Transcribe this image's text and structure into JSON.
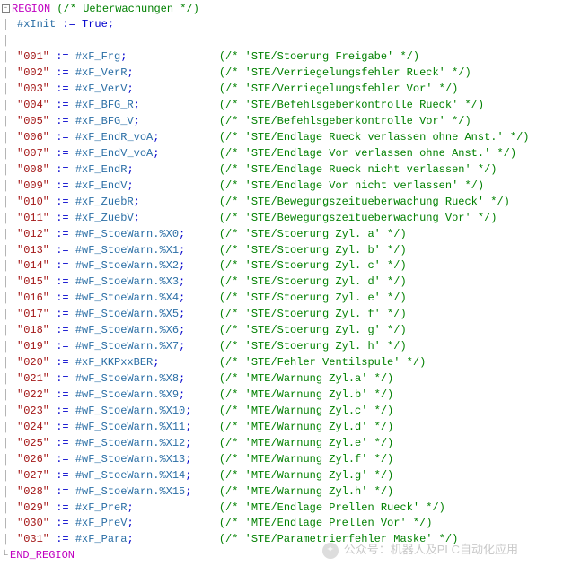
{
  "region": {
    "open_kw": "REGION",
    "close_kw": "END_REGION",
    "label_cmt": "(/* Ueberwachungen */)"
  },
  "init": {
    "target": "#xInit",
    "assign": ":=",
    "value": "True",
    "semi": ";"
  },
  "rows": [
    {
      "key": "\"001\"",
      "op": ":=",
      "var": "#xF_Frg",
      "semi": ";",
      "cmt": "(/* 'STE/Stoerung Freigabe' */)"
    },
    {
      "key": "\"002\"",
      "op": ":=",
      "var": "#xF_VerR",
      "semi": ";",
      "cmt": "(/* 'STE/Verriegelungsfehler Rueck' */)"
    },
    {
      "key": "\"003\"",
      "op": ":=",
      "var": "#xF_VerV",
      "semi": ";",
      "cmt": "(/* 'STE/Verriegelungsfehler Vor' */)"
    },
    {
      "key": "\"004\"",
      "op": ":=",
      "var": "#xF_BFG_R",
      "semi": ";",
      "cmt": "(/* 'STE/Befehlsgeberkontrolle Rueck' */)"
    },
    {
      "key": "\"005\"",
      "op": ":=",
      "var": "#xF_BFG_V",
      "semi": ";",
      "cmt": "(/* 'STE/Befehlsgeberkontrolle Vor' */)"
    },
    {
      "key": "\"006\"",
      "op": ":=",
      "var": "#xF_EndR_voA",
      "semi": ";",
      "cmt": "(/* 'STE/Endlage Rueck verlassen ohne Anst.' */)"
    },
    {
      "key": "\"007\"",
      "op": ":=",
      "var": "#xF_EndV_voA",
      "semi": ";",
      "cmt": "(/* 'STE/Endlage Vor verlassen ohne Anst.' */)"
    },
    {
      "key": "\"008\"",
      "op": ":=",
      "var": "#xF_EndR",
      "semi": ";",
      "cmt": "(/* 'STE/Endlage Rueck nicht verlassen' */)"
    },
    {
      "key": "\"009\"",
      "op": ":=",
      "var": "#xF_EndV",
      "semi": ";",
      "cmt": "(/* 'STE/Endlage Vor nicht verlassen' */)"
    },
    {
      "key": "\"010\"",
      "op": ":=",
      "var": "#xF_ZuebR",
      "semi": ";",
      "cmt": "(/* 'STE/Bewegungszeitueberwachung Rueck' */)"
    },
    {
      "key": "\"011\"",
      "op": ":=",
      "var": "#xF_ZuebV",
      "semi": ";",
      "cmt": "(/* 'STE/Bewegungszeitueberwachung Vor' */)"
    },
    {
      "key": "\"012\"",
      "op": ":=",
      "var": "#wF_StoeWarn.%X0",
      "semi": ";",
      "cmt": "(/* 'STE/Stoerung Zyl. a' */)"
    },
    {
      "key": "\"013\"",
      "op": ":=",
      "var": "#wF_StoeWarn.%X1",
      "semi": ";",
      "cmt": "(/* 'STE/Stoerung Zyl. b' */)"
    },
    {
      "key": "\"014\"",
      "op": ":=",
      "var": "#wF_StoeWarn.%X2",
      "semi": ";",
      "cmt": "(/* 'STE/Stoerung Zyl. c' */)"
    },
    {
      "key": "\"015\"",
      "op": ":=",
      "var": "#wF_StoeWarn.%X3",
      "semi": ";",
      "cmt": "(/* 'STE/Stoerung Zyl. d' */)"
    },
    {
      "key": "\"016\"",
      "op": ":=",
      "var": "#wF_StoeWarn.%X4",
      "semi": ";",
      "cmt": "(/* 'STE/Stoerung Zyl. e' */)"
    },
    {
      "key": "\"017\"",
      "op": ":=",
      "var": "#wF_StoeWarn.%X5",
      "semi": ";",
      "cmt": "(/* 'STE/Stoerung Zyl. f' */)"
    },
    {
      "key": "\"018\"",
      "op": ":=",
      "var": "#wF_StoeWarn.%X6",
      "semi": ";",
      "cmt": "(/* 'STE/Stoerung Zyl. g' */)"
    },
    {
      "key": "\"019\"",
      "op": ":=",
      "var": "#wF_StoeWarn.%X7",
      "semi": ";",
      "cmt": "(/* 'STE/Stoerung Zyl. h' */)"
    },
    {
      "key": "\"020\"",
      "op": ":=",
      "var": "#xF_KKPxxBER",
      "semi": ";",
      "cmt": "(/* 'STE/Fehler Ventilspule' */)"
    },
    {
      "key": "\"021\"",
      "op": ":=",
      "var": "#wF_StoeWarn.%X8",
      "semi": ";",
      "cmt": "(/* 'MTE/Warnung Zyl.a' */)"
    },
    {
      "key": "\"022\"",
      "op": ":=",
      "var": "#wF_StoeWarn.%X9",
      "semi": ";",
      "cmt": "(/* 'MTE/Warnung Zyl.b' */)"
    },
    {
      "key": "\"023\"",
      "op": ":=",
      "var": "#wF_StoeWarn.%X10",
      "semi": ";",
      "cmt": "(/* 'MTE/Warnung Zyl.c' */)"
    },
    {
      "key": "\"024\"",
      "op": ":=",
      "var": "#wF_StoeWarn.%X11",
      "semi": ";",
      "cmt": "(/* 'MTE/Warnung Zyl.d' */)"
    },
    {
      "key": "\"025\"",
      "op": ":=",
      "var": "#wF_StoeWarn.%X12",
      "semi": ";",
      "cmt": "(/* 'MTE/Warnung Zyl.e' */)"
    },
    {
      "key": "\"026\"",
      "op": ":=",
      "var": "#wF_StoeWarn.%X13",
      "semi": ";",
      "cmt": "(/* 'MTE/Warnung Zyl.f' */)"
    },
    {
      "key": "\"027\"",
      "op": ":=",
      "var": "#wF_StoeWarn.%X14",
      "semi": ";",
      "cmt": "(/* 'MTE/Warnung Zyl.g' */)"
    },
    {
      "key": "\"028\"",
      "op": ":=",
      "var": "#wF_StoeWarn.%X15",
      "semi": ";",
      "cmt": "(/* 'MTE/Warnung Zyl.h' */)"
    },
    {
      "key": "\"029\"",
      "op": ":=",
      "var": "#xF_PreR",
      "semi": ";",
      "cmt": "(/* 'MTE/Endlage Prellen Rueck' */)"
    },
    {
      "key": "\"030\"",
      "op": ":=",
      "var": "#xF_PreV",
      "semi": ";",
      "cmt": "(/* 'MTE/Endlage Prellen Vor' */)"
    },
    {
      "key": "\"031\"",
      "op": ":=",
      "var": "#xF_Para",
      "semi": ";",
      "cmt": "(/* 'STE/Parametrierfehler Maske' */)"
    }
  ],
  "watermark": "公众号：机器人及PLC自动化应用"
}
